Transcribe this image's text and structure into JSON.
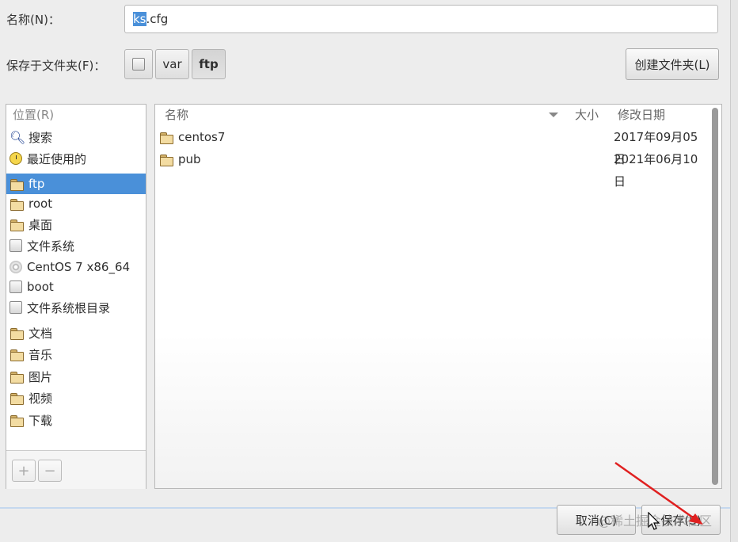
{
  "name_row": {
    "label": "名称(N)：",
    "value_selected": "ks",
    "value_rest": ".cfg"
  },
  "folder_row": {
    "label": "保存于文件夹(F)：",
    "path": [
      "var",
      "ftp"
    ],
    "create_folder": "创建文件夹(L)"
  },
  "sidebar": {
    "header": "位置(R)",
    "items": [
      {
        "label": "搜索",
        "icon": "search-icon"
      },
      {
        "label": "最近使用的",
        "icon": "recent-icon"
      },
      {
        "label": "ftp",
        "icon": "folder-icon",
        "selected": true
      },
      {
        "label": "root",
        "icon": "home-folder-icon"
      },
      {
        "label": "桌面",
        "icon": "desktop-folder-icon"
      },
      {
        "label": "文件系统",
        "icon": "drive-icon"
      },
      {
        "label": "CentOS 7 x86_64",
        "icon": "disc-icon"
      },
      {
        "label": "boot",
        "icon": "drive-icon"
      },
      {
        "label": "文件系统根目录",
        "icon": "drive-icon"
      },
      {
        "label": "文档",
        "icon": "documents-folder-icon"
      },
      {
        "label": "音乐",
        "icon": "music-folder-icon"
      },
      {
        "label": "图片",
        "icon": "pictures-folder-icon"
      },
      {
        "label": "视频",
        "icon": "videos-folder-icon"
      },
      {
        "label": "下载",
        "icon": "downloads-folder-icon"
      }
    ],
    "add_label": "+",
    "remove_label": "−"
  },
  "files": {
    "columns": {
      "name": "名称",
      "size": "大小",
      "modified": "修改日期"
    },
    "rows": [
      {
        "name": "centos7",
        "modified": "2017年09月05日"
      },
      {
        "name": "pub",
        "modified": "2021年06月10日"
      }
    ]
  },
  "buttons": {
    "cancel": "取消(C)",
    "save": "保存(S)"
  },
  "watermark": "@稀土掘金技术社区",
  "colors": {
    "selection": "#4a90d9",
    "annotation_arrow": "#e02020"
  }
}
